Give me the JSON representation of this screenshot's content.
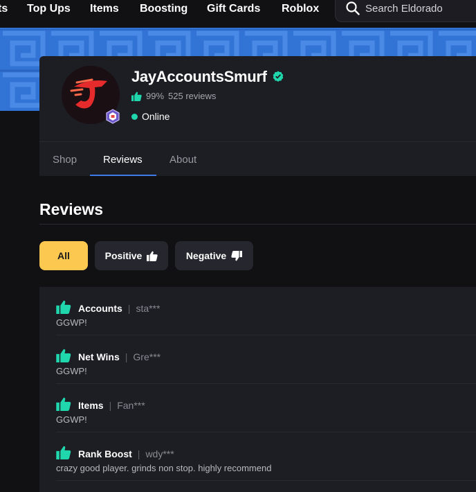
{
  "nav": {
    "items": [
      "ts",
      "Top Ups",
      "Items",
      "Boosting",
      "Gift Cards",
      "Roblox"
    ],
    "search_placeholder": "Search Eldorado"
  },
  "profile": {
    "username": "JayAccountsSmurf",
    "rating_percent": "99%",
    "review_count": "525 reviews",
    "status": "Online"
  },
  "tabs": [
    {
      "label": "Shop",
      "active": false
    },
    {
      "label": "Reviews",
      "active": true
    },
    {
      "label": "About",
      "active": false
    }
  ],
  "reviews_section": {
    "title": "Reviews",
    "filters": {
      "all": "All",
      "positive": "Positive",
      "negative": "Negative"
    }
  },
  "reviews": [
    {
      "category": "Accounts",
      "user": "sta***",
      "text": "GGWP!"
    },
    {
      "category": "Net Wins",
      "user": "Gre***",
      "text": "GGWP!"
    },
    {
      "category": "Items",
      "user": "Fan***",
      "text": "GGWP!"
    },
    {
      "category": "Rank Boost",
      "user": "wdy***",
      "text": "crazy good player. grinds non stop. highly recommend"
    }
  ],
  "colors": {
    "accent_teal": "#20d6ad",
    "accent_yellow": "#fcc850",
    "tab_underline": "#3d7ae6",
    "banner_blue": "#2f6fd0"
  },
  "icons": [
    "search-icon",
    "thumbs-up-icon",
    "thumbs-down-icon",
    "verified-check-icon",
    "seller-rank-badge-icon",
    "online-dot-icon"
  ]
}
